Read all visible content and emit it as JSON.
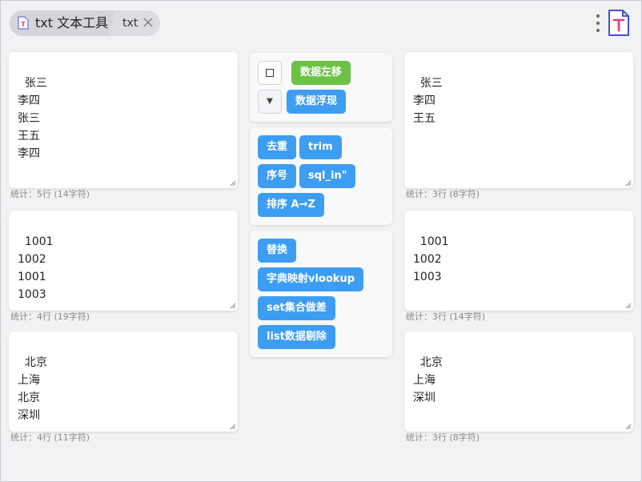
{
  "tab": {
    "title": "txt 文本工具",
    "sub_title": "txt"
  },
  "left": [
    {
      "text": "张三\n李四\n张三\n王五\n李四",
      "stat": "统计：5行 (14字符)"
    },
    {
      "text": "1001\n1002\n1001\n1003",
      "stat": "统计：4行 (19字符)"
    },
    {
      "text": "北京\n上海\n北京\n深圳",
      "stat": "统计：4行 (11字符)"
    }
  ],
  "right": [
    {
      "text": "张三\n李四\n王五",
      "stat": "统计：3行 (8字符)"
    },
    {
      "text": "1001\n1002\n1003",
      "stat": "统计：3行 (14字符)"
    },
    {
      "text": "北京\n上海\n深圳",
      "stat": "统计：3行 (8字符)"
    }
  ],
  "controls": {
    "shift_left": "数据左移",
    "float_data": "数据浮现",
    "dropdown_glyph": "▼"
  },
  "ops": {
    "dedupe": "去重",
    "trim": "trim",
    "number": "序号",
    "sql_in": "sql_in\"",
    "sort": "排序 A→Z"
  },
  "advanced": {
    "replace": "替换",
    "dict_map": "字典映射vlookup",
    "set_diff": "set集合做差",
    "list_remove": "list数据剔除"
  },
  "colors": {
    "primary": "#3d9df3",
    "success": "#6cc244",
    "background": "#f1f2f4"
  }
}
